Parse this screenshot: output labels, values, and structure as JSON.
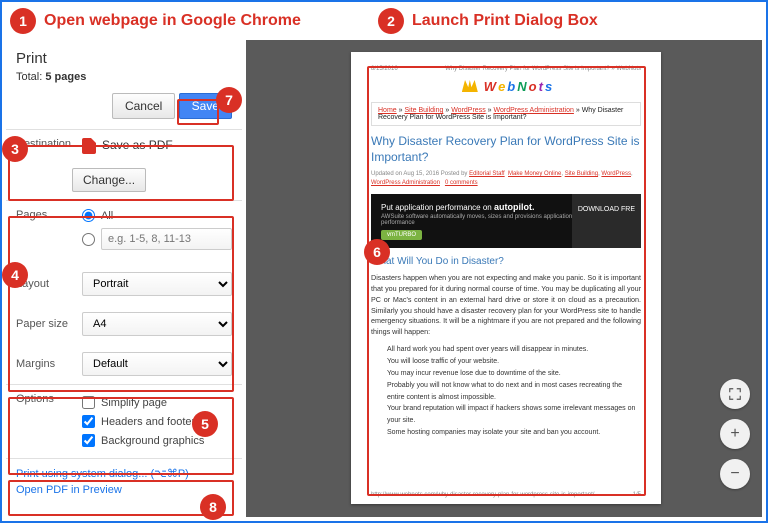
{
  "callouts": {
    "c1": "Open webpage in Google Chrome",
    "c2": "Launch Print Dialog Box"
  },
  "print": {
    "title": "Print",
    "total_prefix": "Total: ",
    "total_value": "5 pages",
    "cancel": "Cancel",
    "save": "Save",
    "destination_label": "Destination",
    "destination_value": "Save as PDF",
    "change": "Change...",
    "pages_label": "Pages",
    "pages_all": "All",
    "pages_placeholder": "e.g. 1-5, 8, 11-13",
    "layout_label": "Layout",
    "layout_value": "Portrait",
    "paper_label": "Paper size",
    "paper_value": "A4",
    "margins_label": "Margins",
    "margins_value": "Default",
    "options_label": "Options",
    "opt_simplify": "Simplify page",
    "opt_headers": "Headers and footers",
    "opt_bg": "Background graphics",
    "link_system": "Print using system dialog... (⌥⌘P)",
    "link_preview": "Open PDF in Preview"
  },
  "page": {
    "date": "8/15/2016",
    "header_title": "Why Disaster Recovery Plan for WordPress Site is Important? » WebNots",
    "logo_text": "WebNots",
    "breadcrumb": {
      "home": "Home",
      "a": "Site Building",
      "b": "WordPress",
      "c": "WordPress Administration",
      "tail": " » Why Disaster Recovery Plan for WordPress Site is Important?"
    },
    "title": "Why Disaster Recovery Plan for WordPress Site is Important?",
    "meta_prefix": "Updated on Aug 15, 2016    Posted by ",
    "meta_author": "Editorial Staff",
    "meta_cat1": "Make Money Online",
    "meta_cat2": "Site Building",
    "meta_cat3": "WordPress",
    "meta_cat4": "WordPress Administration",
    "meta_comments": "0 comments",
    "banner_h": "Put application performance on ",
    "banner_hb": "autopilot.",
    "banner_sub": "AWSuite software automatically moves, sizes and provisions applications to guarantee performance",
    "banner_turbo": "vmTURBO",
    "banner_dl": "DOWNLOAD FRE",
    "h2": "What Will You Do in Disaster?",
    "para": "Disasters happen when you are not expecting and make you panic. So it is important that you prepared for it during normal course of time. You may be duplicating all your PC or Mac's content in an external hard drive or store it on cloud as a precaution. Similarly you should have a disaster recovery plan for your WordPress site to handle emergency situations. It will be a nightmare if you are not prepared and the following things will happen:",
    "b1": "All hard work you had spent over years will disappear in minutes.",
    "b2": "You will loose traffic of your website.",
    "b3": "You may incur revenue lose due to downtime of the site.",
    "b4": "Probably you will not know what to do next and in most cases recreating the entire content is almost impossible.",
    "b5": "Your brand reputation will impact if hackers shows some irrelevant messages on your site.",
    "b6": "Some hosting companies may isolate your site and ban you account.",
    "footer_url": "http://www.webnots.com/why-disaster-recovery-plan-for-wordpress-site-is-important/",
    "footer_pg": "1/5"
  }
}
